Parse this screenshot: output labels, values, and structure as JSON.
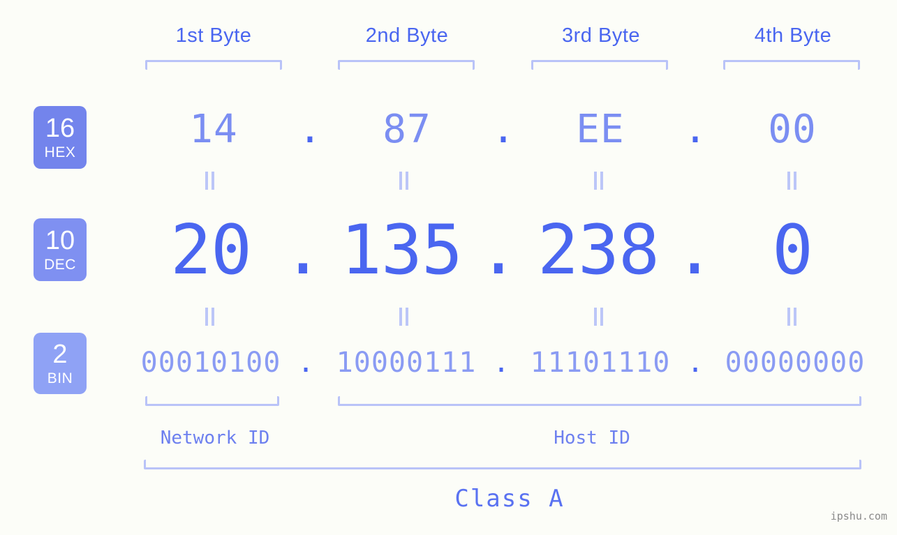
{
  "background_color": "#fcfdf8",
  "accent_color": "#4a66f0",
  "light_accent_color": "#b9c3f8",
  "byte_headers": [
    {
      "label": "1st Byte"
    },
    {
      "label": "2nd Byte"
    },
    {
      "label": "3rd Byte"
    },
    {
      "label": "4th Byte"
    }
  ],
  "rows": {
    "hex": {
      "badge_number": "16",
      "badge_name": "HEX",
      "badge_color": "#7384ec",
      "separator": ".",
      "values": [
        "14",
        "87",
        "EE",
        "00"
      ]
    },
    "dec": {
      "badge_number": "10",
      "badge_name": "DEC",
      "badge_color": "#7f90f1",
      "separator": ".",
      "values": [
        "20",
        "135",
        "238",
        "0"
      ]
    },
    "bin": {
      "badge_number": "2",
      "badge_name": "BIN",
      "badge_color": "#8fa2f5",
      "separator": ".",
      "values": [
        "00010100",
        "10000111",
        "11101110",
        "00000000"
      ]
    }
  },
  "equality_symbol": "=",
  "id_sections": [
    {
      "label": "Network ID"
    },
    {
      "label": "Host ID"
    }
  ],
  "class_label": "Class A",
  "watermark": "ipshu.com"
}
